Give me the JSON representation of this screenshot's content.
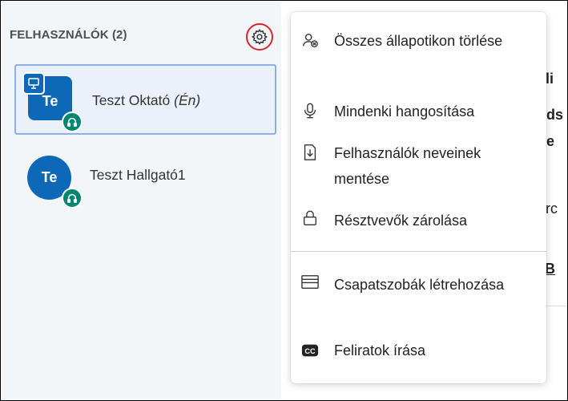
{
  "sidebar": {
    "title": "FELHASZNÁLÓK (2)",
    "users": [
      {
        "initials": "Te",
        "name": "Teszt Oktató",
        "self_tag": "(Én)",
        "avatar_color": "#0d69b8",
        "presenter": true,
        "selected": true
      },
      {
        "initials": "Te",
        "name": "Teszt Hallgató1",
        "self_tag": "",
        "avatar_color": "#0d69b8",
        "presenter": false,
        "selected": false
      }
    ],
    "audio_badge_color": "#00856f",
    "highlight_color": "#d9262e"
  },
  "menu": {
    "items": [
      {
        "label": "Összes állapotikon törlése",
        "icon": "clear-status-icon"
      },
      {
        "label": "Mindenki hangosítása",
        "icon": "microphone-icon"
      },
      {
        "label": "Felhasználók neveinek mentése",
        "icon": "download-icon"
      },
      {
        "label": "Résztvevők zárolása",
        "icon": "lock-icon"
      },
      {
        "label": "Csapatszobák létrehozása",
        "icon": "breakout-rooms-icon"
      },
      {
        "label": "Feliratok írása",
        "icon": "closed-captions-icon"
      }
    ]
  },
  "background_fragments": [
    ":cli",
    "nds",
    "he",
    "orc",
    "gB"
  ]
}
